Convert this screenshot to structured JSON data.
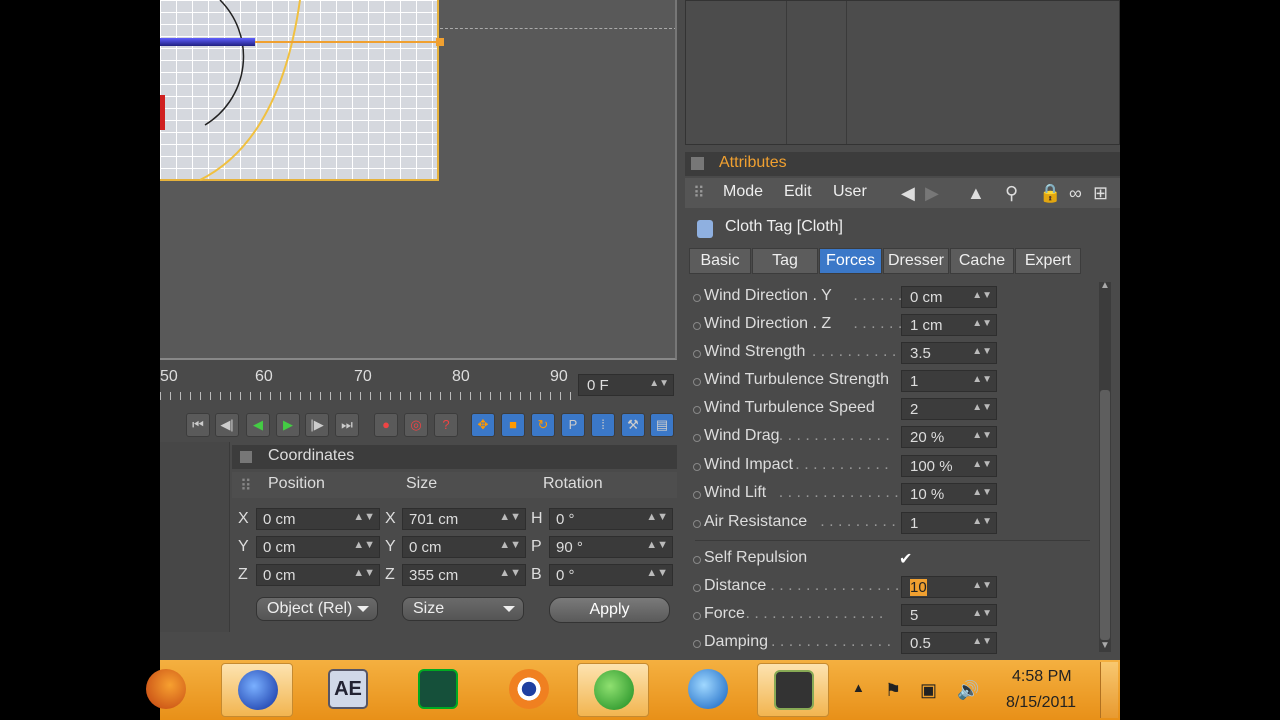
{
  "viewport": {},
  "timeline": {
    "ticks": [
      "50",
      "60",
      "70",
      "80",
      "90"
    ],
    "frame_value": "0 F"
  },
  "coordinates": {
    "title": "Coordinates",
    "headers": {
      "position": "Position",
      "size": "Size",
      "rotation": "Rotation"
    },
    "rows": [
      {
        "pos_axis": "X",
        "pos": "0 cm",
        "size_axis": "X",
        "size": "701 cm",
        "rot_axis": "H",
        "rot": "0 °"
      },
      {
        "pos_axis": "Y",
        "pos": "0 cm",
        "size_axis": "Y",
        "size": "0 cm",
        "rot_axis": "P",
        "rot": "90 °"
      },
      {
        "pos_axis": "Z",
        "pos": "0 cm",
        "size_axis": "Z",
        "size": "355 cm",
        "rot_axis": "B",
        "rot": "0 °"
      }
    ],
    "mode_dropdown": "Object (Rel)",
    "size_dropdown": "Size",
    "apply_label": "Apply"
  },
  "attributes": {
    "title": "Attributes",
    "menu": {
      "mode": "Mode",
      "edit": "Edit",
      "user": "User"
    },
    "tag_title": "Cloth Tag [Cloth]",
    "tabs": [
      "Basic",
      "Tag",
      "Forces",
      "Dresser",
      "Cache",
      "Expert"
    ],
    "active_tab": "Forces",
    "params": [
      {
        "label": "Wind Direction . Y",
        "dots": " . . . . . .",
        "value": "0 cm"
      },
      {
        "label": "Wind Direction . Z",
        "dots": " . . . . . .",
        "value": "1 cm"
      },
      {
        "label": "Wind Strength",
        "dots": " . . . . . . . . . .",
        "value": "3.5"
      },
      {
        "label": "Wind Turbulence Strength",
        "dots": "",
        "value": "1"
      },
      {
        "label": "Wind Turbulence Speed",
        "dots": "",
        "value": "2"
      },
      {
        "label": "Wind Drag",
        "dots": " . . . . . . . . . . . . .",
        "value": "20 %"
      },
      {
        "label": "Wind Impact",
        "dots": " . . . . . . . . . . .",
        "value": "100 %"
      },
      {
        "label": "Wind Lift",
        "dots": ". . . . . . . . . . . . . .",
        "value": "10 %"
      },
      {
        "label": "Air Resistance",
        "dots": " . . . . . . . . .",
        "value": "1"
      }
    ],
    "params2": [
      {
        "label": "Self Repulsion",
        "dots": "",
        "value": "✔"
      },
      {
        "label": "Distance",
        "dots": ". . . . . . . . . . . . . . .",
        "value": "10"
      },
      {
        "label": "Force",
        "dots": " . . . . . . . . . . . . . . . .",
        "value": "5"
      },
      {
        "label": "Damping",
        "dots": ". . . . . . . . . . . . . . .",
        "value": "0.5"
      }
    ]
  },
  "taskbar": {
    "time": "4:58 PM",
    "date": "8/15/2011",
    "apps": [
      "firefox-icon",
      "globe-icon",
      "after-effects-icon",
      "app-s-icon",
      "blender-icon",
      "ie-icon",
      "quicktime-icon",
      "camera-icon"
    ],
    "ae_label": "AE"
  }
}
